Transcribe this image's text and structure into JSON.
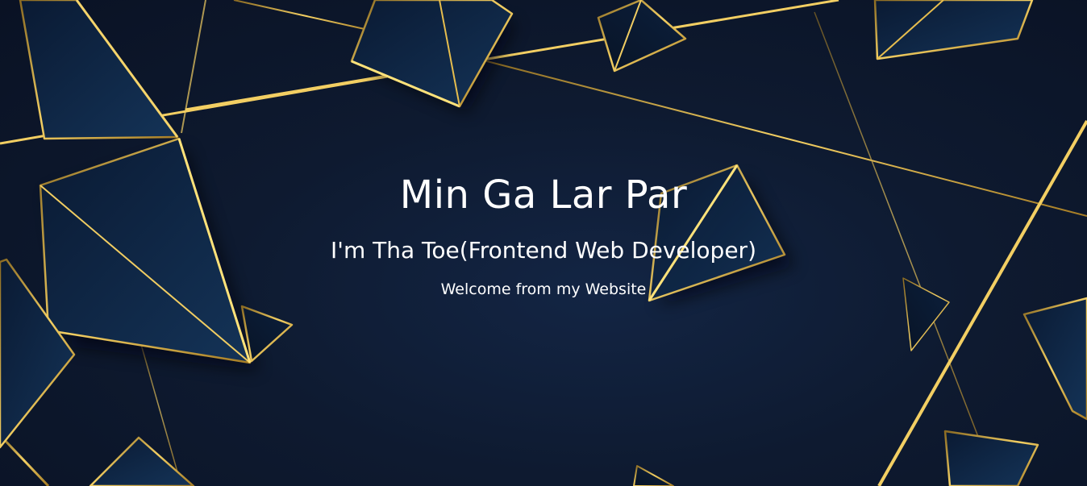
{
  "hero": {
    "title": "Min Ga Lar Par",
    "subtitle": "I'm Tha Toe(Frontend Web Developer)",
    "welcome": "Welcome from my Website"
  },
  "colors": {
    "background": "#0d1628",
    "shape_fill": "#0f2745",
    "gold": "#d4a63a",
    "gold_highlight": "#ffe27a",
    "text": "#ffffff"
  }
}
